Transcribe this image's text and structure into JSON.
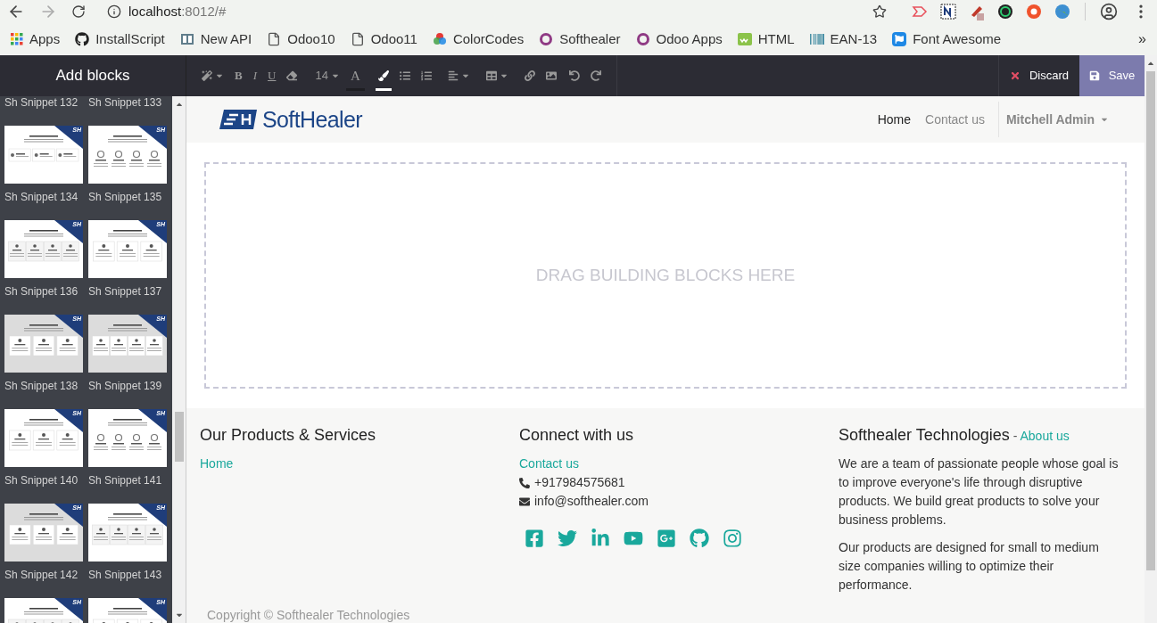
{
  "browser": {
    "host": "localhost",
    "path": ":8012/#",
    "bookmarks": [
      "Apps",
      "InstallScript",
      "New API",
      "Odoo10",
      "Odoo11",
      "ColorCodes",
      "Softhealer",
      "Odoo Apps",
      "HTML",
      "EAN-13",
      "Font Awesome"
    ],
    "more": "»"
  },
  "editor": {
    "title": "Add blocks",
    "toolbar": [
      {
        "kind": "wand",
        "caret": true,
        "selected": false
      },
      {
        "kind": "bold",
        "text": "B",
        "caret": false,
        "selected": false
      },
      {
        "kind": "italic",
        "text": "I",
        "caret": false,
        "selected": false
      },
      {
        "kind": "underline",
        "text": "U",
        "caret": false,
        "selected": false
      },
      {
        "kind": "eraser",
        "caret": false,
        "selected": false
      },
      {
        "kind": "size",
        "text": "14",
        "caret": true,
        "selected": false
      },
      {
        "kind": "fontcolor",
        "text": "A",
        "caret": false,
        "selected": false
      },
      {
        "kind": "brush",
        "caret": false,
        "selected": true
      },
      {
        "kind": "bullets",
        "caret": false,
        "selected": false
      },
      {
        "kind": "numbers",
        "caret": false,
        "selected": false
      },
      {
        "kind": "align",
        "caret": true,
        "selected": false
      },
      {
        "kind": "table",
        "caret": true,
        "selected": false
      },
      {
        "kind": "link",
        "caret": false,
        "selected": false
      },
      {
        "kind": "image",
        "caret": false,
        "selected": false
      },
      {
        "kind": "undo",
        "caret": false,
        "selected": false
      },
      {
        "kind": "redo",
        "caret": false,
        "selected": false
      }
    ],
    "discard": "Discard",
    "save": "Save"
  },
  "snippet_rows": [
    [
      {
        "label": "Sh Snippet 132"
      },
      {
        "label": "Sh Snippet 133"
      }
    ],
    [
      {
        "label": "Sh Snippet 134",
        "kind": "dots",
        "gray": false,
        "badge": "SH"
      },
      {
        "label": "Sh Snippet 135",
        "kind": "rings",
        "gray": false,
        "badge": "SH"
      }
    ],
    [
      {
        "label": "Sh Snippet 136",
        "kind": "quad",
        "gray": false,
        "badge": "SH"
      },
      {
        "label": "Sh Snippet 137",
        "kind": "triple",
        "gray": false,
        "badge": "SH"
      }
    ],
    [
      {
        "label": "Sh Snippet 138",
        "kind": "triple",
        "gray": true,
        "badge": "SH"
      },
      {
        "label": "Sh Snippet 139",
        "kind": "quad",
        "gray": true,
        "badge": "SH"
      }
    ],
    [
      {
        "label": "Sh Snippet 140",
        "kind": "triple",
        "gray": false,
        "badge": "SH"
      },
      {
        "label": "Sh Snippet 141",
        "kind": "rings",
        "gray": false,
        "badge": "SH"
      }
    ],
    [
      {
        "label": "Sh Snippet 142",
        "kind": "triple",
        "gray": true,
        "badge": "SH"
      },
      {
        "label": "Sh Snippet 143",
        "kind": "quad",
        "gray": false,
        "badge": "SH"
      }
    ],
    [
      {
        "kind": "quad",
        "gray": false,
        "badge": "SH"
      },
      {
        "kind": "triple",
        "gray": false,
        "badge": "SH"
      }
    ]
  ],
  "site": {
    "logo": "SoftHealer",
    "menu": [
      {
        "label": "Home",
        "selected": true
      },
      {
        "label": "Contact us",
        "selected": false
      }
    ],
    "user": "Mitchell Admin",
    "dropzone": "DRAG BUILDING BLOCKS HERE",
    "footer": {
      "products": {
        "title": "Our Products & Services",
        "link": "Home"
      },
      "connect": {
        "title": "Connect with us",
        "link": "Contact us",
        "phone": "+917984575681",
        "email": "info@softhealer.com"
      },
      "about": {
        "title": "Softhealer Technologies",
        "separator": "-",
        "link": "About us",
        "paragraphs": [
          "We are a team of passionate people whose goal is to improve everyone's life through disruptive products. We build great products to solve your business problems.",
          "Our products are designed for small to medium size companies willing to optimize their performance."
        ]
      },
      "copyright": "Copyright © Softhealer Technologies"
    }
  }
}
